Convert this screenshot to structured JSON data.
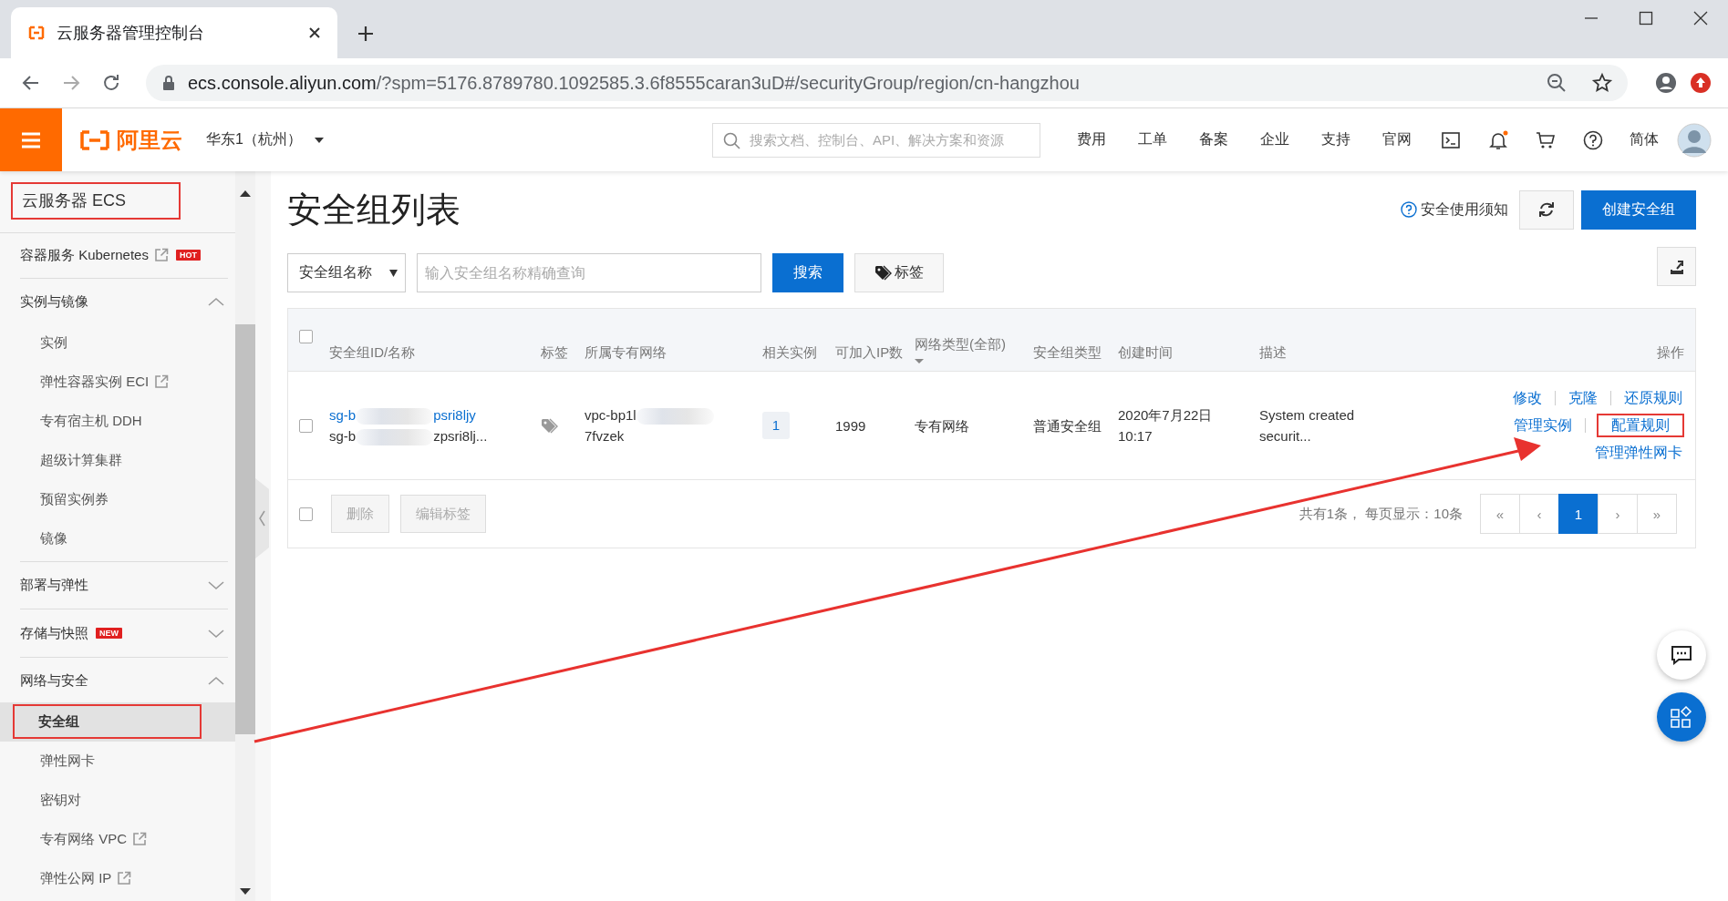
{
  "browser": {
    "tab_title": "云服务器管理控制台",
    "url_host": "ecs.console.aliyun.com",
    "url_rest": "/?spm=5176.8789780.1092585.3.6f8555caran3uD#/securityGroup/region/cn-hangzhou"
  },
  "top_nav": {
    "logo": "阿里云",
    "region": "华东1（杭州）",
    "search": {
      "placeholder": "搜索文档、控制台、API、解决方案和资源"
    },
    "links": [
      "费用",
      "工单",
      "备案",
      "企业",
      "支持",
      "官网"
    ],
    "language": "简体"
  },
  "sidebar": {
    "title": "云服务器 ECS",
    "title_highlighted": true,
    "sections": [
      {
        "kind": "link",
        "label": "容器服务 Kubernetes",
        "external": true,
        "badge": "HOT"
      },
      {
        "kind": "group",
        "label": "实例与镜像",
        "expanded": true,
        "children": [
          {
            "label": "实例",
            "external": false,
            "selected": false,
            "highlighted": false
          },
          {
            "label": "弹性容器实例 ECI",
            "external": true,
            "selected": false,
            "highlighted": false
          },
          {
            "label": "专有宿主机 DDH",
            "external": false,
            "selected": false,
            "highlighted": false
          },
          {
            "label": "超级计算集群",
            "external": false,
            "selected": false,
            "highlighted": false
          },
          {
            "label": "预留实例券",
            "external": false,
            "selected": false,
            "highlighted": false
          },
          {
            "label": "镜像",
            "external": false,
            "selected": false,
            "highlighted": false
          }
        ]
      },
      {
        "kind": "group",
        "label": "部署与弹性",
        "expanded": false
      },
      {
        "kind": "group",
        "label": "存储与快照",
        "expanded": false,
        "badge": "NEW"
      },
      {
        "kind": "group",
        "label": "网络与安全",
        "expanded": true,
        "children": [
          {
            "label": "安全组",
            "external": false,
            "selected": true,
            "highlighted": true
          },
          {
            "label": "弹性网卡",
            "external": false,
            "selected": false,
            "highlighted": false
          },
          {
            "label": "密钥对",
            "external": false,
            "selected": false,
            "highlighted": false
          },
          {
            "label": "专有网络 VPC",
            "external": true,
            "selected": false,
            "highlighted": false
          },
          {
            "label": "弹性公网 IP",
            "external": true,
            "selected": false,
            "highlighted": false
          }
        ]
      }
    ]
  },
  "page": {
    "title": "安全组列表",
    "help_link": "安全使用须知",
    "create_button": "创建安全组",
    "filter": {
      "field": "安全组名称",
      "placeholder": "输入安全组名称精确查询"
    },
    "search_button": "搜索",
    "tag_button": "标签"
  },
  "table": {
    "all_checked": false,
    "columns": [
      "安全组ID/名称",
      "标签",
      "所属专有网络",
      "相关实例",
      "可加入IP数",
      "网络类型(全部)",
      "安全组类型",
      "创建时间",
      "描述",
      "操作"
    ],
    "rows": [
      {
        "checked": false,
        "id_prefix": "sg-b",
        "id_suffix": "psri8ljy",
        "name_prefix": "sg-b",
        "name_suffix": "zpsri8lj...",
        "vpc_prefix": "vpc-bp1l",
        "vpc_suffix": "7fvzek",
        "instances": "1",
        "ip_count": "1999",
        "network_type": "专有网络",
        "sg_type": "普通安全组",
        "created": "2020年7月22日 10:17",
        "description": "System created securit...",
        "action_rows": [
          {
            "links": [
              {
                "label": "修改",
                "highlighted": false
              },
              {
                "label": "克隆",
                "highlighted": false
              },
              {
                "label": "还原规则",
                "highlighted": false
              }
            ]
          },
          {
            "links": [
              {
                "label": "管理实例",
                "highlighted": false
              },
              {
                "label": "配置规则",
                "highlighted": true
              }
            ]
          },
          {
            "links": [
              {
                "label": "管理弹性网卡",
                "highlighted": false
              }
            ]
          }
        ]
      }
    ],
    "footer_checked": false,
    "bulk_actions": [
      {
        "label": "删除",
        "disabled": true
      },
      {
        "label": "编辑标签",
        "disabled": true
      }
    ],
    "summary": "共有1条， 每页显示：10条",
    "pages": [
      {
        "label": "«",
        "selected": false
      },
      {
        "label": "‹",
        "selected": false
      },
      {
        "label": "1",
        "selected": true
      },
      {
        "label": "›",
        "selected": false
      },
      {
        "label": "»",
        "selected": false
      }
    ]
  }
}
